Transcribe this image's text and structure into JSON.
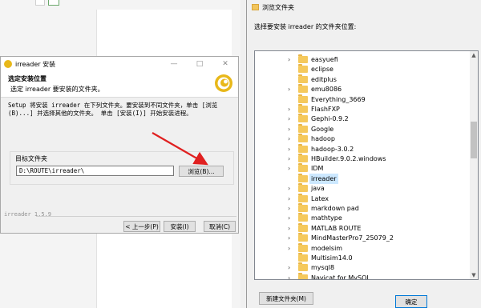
{
  "background": {
    "tabs": [
      "",
      ""
    ]
  },
  "installer": {
    "window_title": "irreader 安装",
    "window_buttons": [
      "—",
      "□",
      "✕"
    ],
    "header_title": "选定安装位置",
    "header_subtitle": "选定 irreader 要安装的文件夹。",
    "description": "Setup 将安装 irreader 在下列文件夹。要安装到不同文件夹，单击 [浏览(B)...] 并选择其他的文件夹。 单击 [安装(I)] 开始安装进程。",
    "group_label": "目标文件夹",
    "path_value": "D:\\ROUTE\\irreader\\",
    "browse_button": "浏览(B)...",
    "brand_text": "irreader 1.5.9",
    "back_button": "< 上一步(P)",
    "install_button": "安装(I)",
    "cancel_button": "取消(C)"
  },
  "folder_dialog": {
    "title": "浏览文件夹",
    "prompt": "选择要安装 irreader 的文件夹位置:",
    "items": [
      {
        "name": "easyuefi",
        "expandable": true
      },
      {
        "name": "eclipse",
        "expandable": false
      },
      {
        "name": "editplus",
        "expandable": false
      },
      {
        "name": "emu8086",
        "expandable": true
      },
      {
        "name": "Everything_3669",
        "expandable": false
      },
      {
        "name": "FlashFXP",
        "expandable": true
      },
      {
        "name": "Gephi-0.9.2",
        "expandable": true
      },
      {
        "name": "Google",
        "expandable": true
      },
      {
        "name": "hadoop",
        "expandable": true
      },
      {
        "name": "hadoop-3.0.2",
        "expandable": true
      },
      {
        "name": "HBuilder.9.0.2.windows",
        "expandable": true
      },
      {
        "name": "IDM",
        "expandable": true
      },
      {
        "name": "irreader",
        "expandable": false,
        "selected": true
      },
      {
        "name": "java",
        "expandable": true
      },
      {
        "name": "Latex",
        "expandable": true
      },
      {
        "name": "markdown pad",
        "expandable": true
      },
      {
        "name": "mathtype",
        "expandable": true
      },
      {
        "name": "MATLAB ROUTE",
        "expandable": true
      },
      {
        "name": "MindMasterPro7_25079_2",
        "expandable": true
      },
      {
        "name": "modelsim",
        "expandable": true
      },
      {
        "name": "Multisim14.0",
        "expandable": false
      },
      {
        "name": "mysql8",
        "expandable": true
      },
      {
        "name": "Navicat for MySQL",
        "expandable": true
      }
    ],
    "new_folder_button": "新建文件夹(M)",
    "ok_button": "确定"
  },
  "colors": {
    "folder": "#f5c95c",
    "selection": "#cce8ff",
    "arrow": "#e02020",
    "logo": "#e8b81a"
  }
}
